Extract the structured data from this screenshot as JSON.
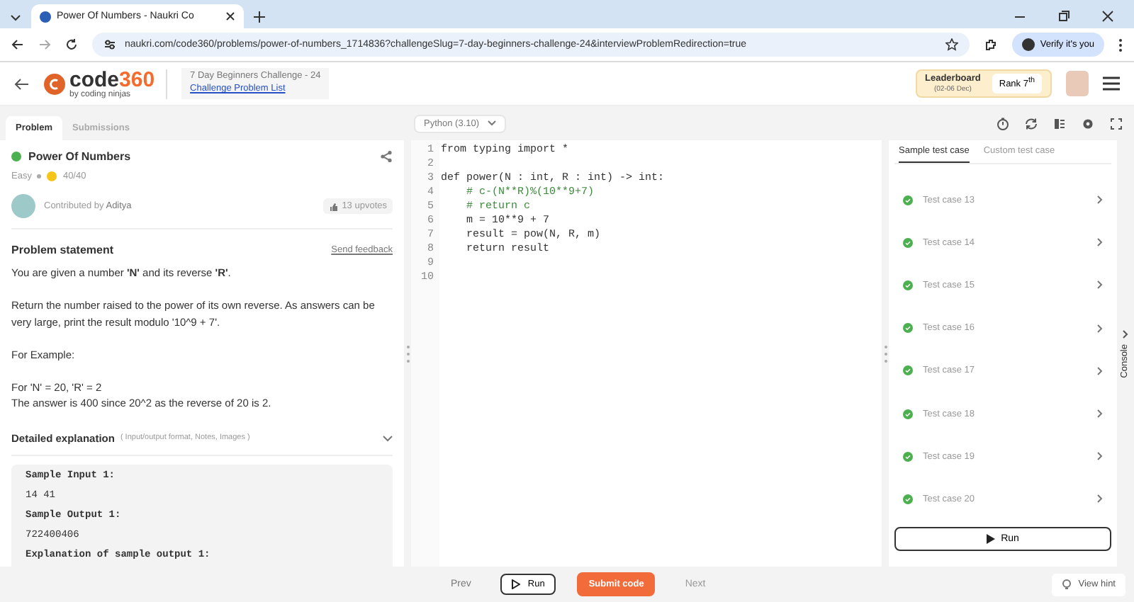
{
  "browser": {
    "tab_title": "Power Of Numbers - Naukri Co",
    "url": "naukri.com/code360/problems/power-of-numbers_1714836?challengeSlug=7-day-beginners-challenge-24&interviewProblemRedirection=true",
    "profile": "Verify it's you"
  },
  "header": {
    "logo": "code",
    "logo_num": "360",
    "logo_by": "by coding ninjas",
    "challenge": "7 Day Beginners Challenge - 24",
    "challenge_link": "Challenge Problem List",
    "leaderboard": "Leaderboard",
    "leaderboard_dates": "(02-06 Dec)",
    "rank": "Rank 7$^{th}$"
  },
  "problem_tabs": [
    {
      "label": "Problem",
      "selected": true
    },
    {
      "label": "Submissions",
      "selected": false
    }
  ],
  "language": "Python (3.10)",
  "problem": {
    "title": "Power Of Numbers",
    "solved": true,
    "difficulty": "Easy",
    "score": "40/40",
    "contributed_by": "Contributed by",
    "author": "Aditya",
    "upvotes": "13 upvotes",
    "statement_heading": "Problem statement",
    "send_feedback": "Send feedback",
    "paragraphs": [
      [
        "You are given a number **'N'** and its reverse **'R'**."
      ],
      [
        "Return the number raised to the power of its own reverse. As answers can be very large, print the result modulo '10^9 + 7'."
      ],
      [
        "For Example:"
      ],
      [
        "For 'N' = 20, 'R' = 2",
        "The answer is 400 since 20^2 as the reverse of 20 is 2."
      ]
    ],
    "explanation_heading": "Detailed explanation",
    "explanation_note": "( Input/output format, Notes, Images )",
    "expanded": false,
    "samples": [
      {
        "kind": "heading",
        "text": "Sample Input 1:"
      },
      {
        "kind": "value",
        "text": "14 41"
      },
      {
        "kind": "heading",
        "text": "Sample Output 1:"
      },
      {
        "kind": "value",
        "text": "722400406"
      },
      {
        "kind": "heading",
        "text": "Explanation of sample output 1:"
      }
    ]
  },
  "code": [
    {
      "number": "1",
      "kind": "code",
      "text": "from typing import *"
    },
    {
      "number": "2"
    },
    {
      "number": "3",
      "kind": "code",
      "text": "def power(N : int, R : int) -> int:"
    },
    {
      "number": "4",
      "kind": "comment",
      "text": "    # c-(N**R)%(10**9+7)"
    },
    {
      "number": "5",
      "kind": "comment",
      "text": "    # return c"
    },
    {
      "number": "6",
      "kind": "code",
      "text": "    m = 10**9 + 7"
    },
    {
      "number": "7",
      "kind": "code",
      "text": "    result = pow(N, R, m)"
    },
    {
      "number": "8",
      "kind": "code",
      "text": "    return result"
    },
    {
      "number": "9"
    },
    {
      "number": "10"
    }
  ],
  "test_tabs": [
    {
      "label": "Sample test case",
      "selected": true
    },
    {
      "label": "Custom test case",
      "selected": false
    }
  ],
  "test_cases": [
    {
      "label": "Test case 13",
      "passed": true
    },
    {
      "label": "Test case 14",
      "passed": true
    },
    {
      "label": "Test case 15",
      "passed": true
    },
    {
      "label": "Test case 16",
      "passed": true
    },
    {
      "label": "Test case 17",
      "passed": true
    },
    {
      "label": "Test case 18",
      "passed": true
    },
    {
      "label": "Test case 19",
      "passed": true
    },
    {
      "label": "Test case 20",
      "passed": true
    }
  ],
  "test_run": "Run",
  "console": "Console",
  "footer": {
    "prev": {
      "label": "Prev",
      "disabled": false
    },
    "run": "Run",
    "submit": "Submit code",
    "next": {
      "label": "Next",
      "disabled": true
    },
    "hint": "View hint"
  }
}
